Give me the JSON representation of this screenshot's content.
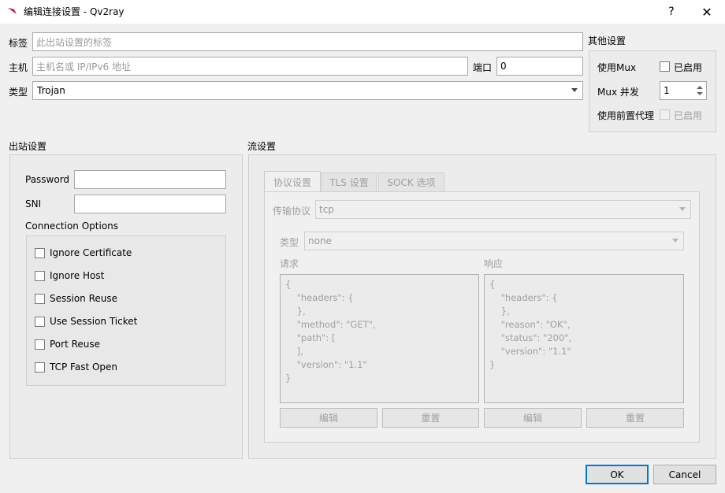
{
  "window": {
    "title": "编辑连接设置 - Qv2ray",
    "help_glyph": "?",
    "close_glyph": "✕"
  },
  "top": {
    "tag_label": "标签",
    "tag_placeholder": "此出站设置的标签",
    "host_label": "主机",
    "host_placeholder": "主机名或 IP/IPv6 地址",
    "port_label": "端口",
    "port_value": "0",
    "type_label": "类型",
    "type_value": "Trojan"
  },
  "other": {
    "title": "其他设置",
    "use_mux_label": "使用Mux",
    "use_mux_checkbox": "已启用",
    "mux_concurrency_label": "Mux 并发",
    "mux_concurrency_value": "1",
    "use_proxy_label": "使用前置代理",
    "use_proxy_checkbox": "已启用"
  },
  "outbound": {
    "title": "出站设置",
    "password_label": "Password",
    "password_value": "",
    "sni_label": "SNI",
    "sni_value": "",
    "conn_options_label": "Connection Options",
    "options": [
      {
        "label": "Ignore Certificate",
        "checked": false
      },
      {
        "label": "Ignore Host",
        "checked": false
      },
      {
        "label": "Session Reuse",
        "checked": false
      },
      {
        "label": "Use Session Ticket",
        "checked": false
      },
      {
        "label": "Port Reuse",
        "checked": false
      },
      {
        "label": "TCP Fast Open",
        "checked": false
      }
    ]
  },
  "stream": {
    "title": "流设置",
    "tabs": [
      "协议设置",
      "TLS 设置",
      "SOCK 选项"
    ],
    "transport_label": "传输协议",
    "transport_value": "tcp",
    "type_label": "类型",
    "type_value": "none",
    "request_label": "请求",
    "response_label": "响应",
    "request_text": "{\n    \"headers\": {\n    },\n    \"method\": \"GET\",\n    \"path\": [\n    ],\n    \"version\": \"1.1\"\n}",
    "response_text": "{\n    \"headers\": {\n    },\n    \"reason\": \"OK\",\n    \"status\": \"200\",\n    \"version\": \"1.1\"\n}",
    "edit_label": "编辑",
    "reset_label": "重置"
  },
  "footer": {
    "ok_label": "OK",
    "cancel_label": "Cancel"
  }
}
